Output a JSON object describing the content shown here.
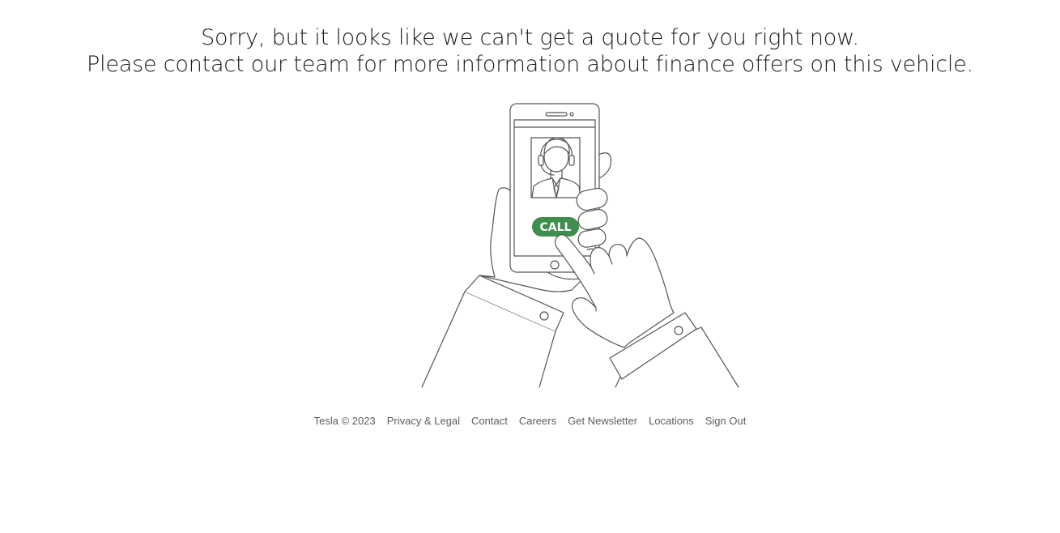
{
  "message": {
    "line1": "Sorry, but it looks like we can't get a quote for you right now.",
    "line2": "Please contact our team for more information about finance offers on this vehicle."
  },
  "illustration": {
    "call_label": "CALL",
    "call_color": "#3e8e4f",
    "stroke_color": "#555555"
  },
  "footer": {
    "copyright": "Tesla © 2023",
    "links": [
      "Privacy & Legal",
      "Contact",
      "Careers",
      "Get Newsletter",
      "Locations",
      "Sign Out"
    ]
  }
}
